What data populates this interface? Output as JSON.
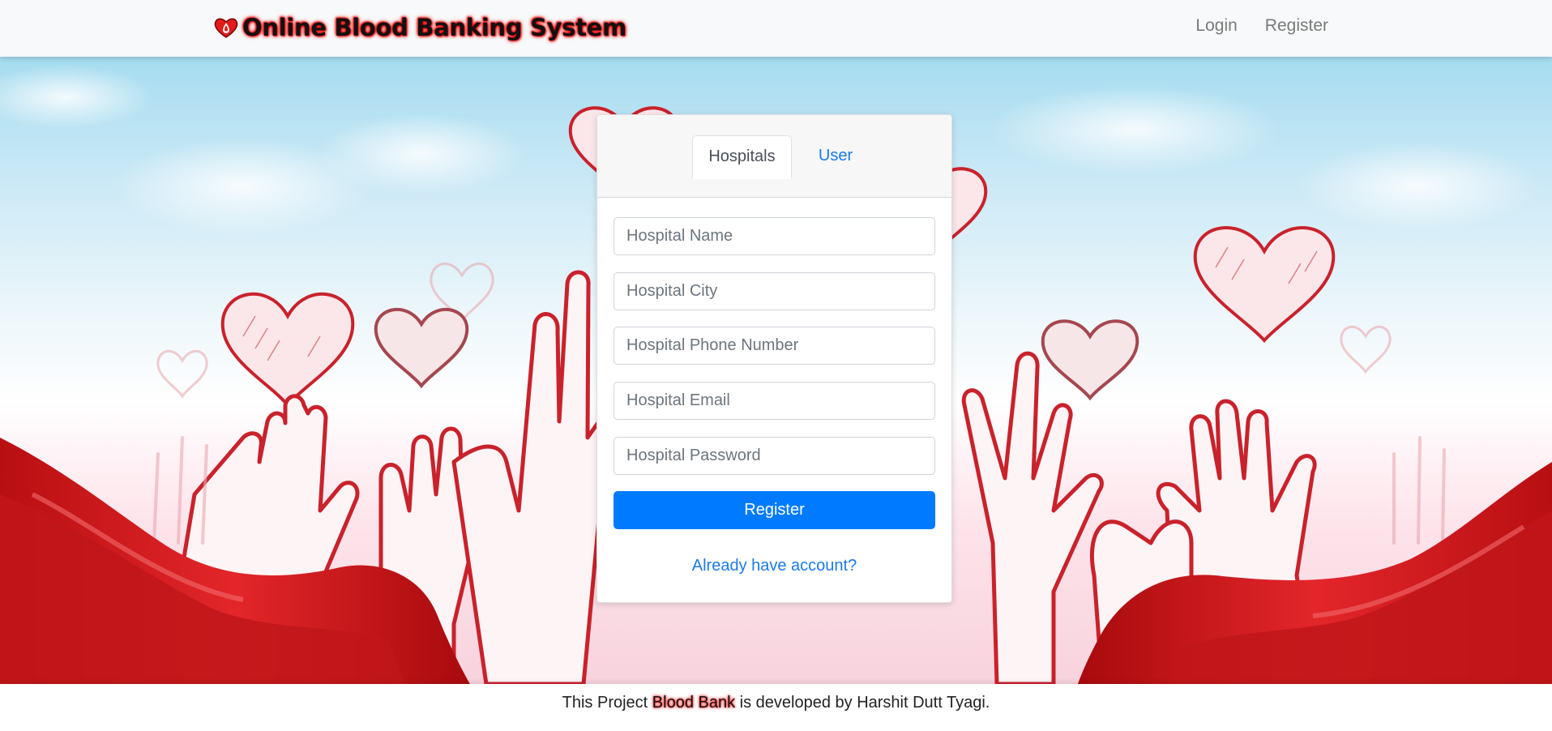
{
  "navbar": {
    "brand_icon": "blood-drop-heart-icon",
    "brand_text": "Online Blood Banking System",
    "links": {
      "login": "Login",
      "register": "Register"
    }
  },
  "card": {
    "tabs": {
      "hospitals": "Hospitals",
      "user": "User"
    },
    "fields": {
      "name_placeholder": "Hospital Name",
      "city_placeholder": "Hospital City",
      "phone_placeholder": "Hospital Phone Number",
      "email_placeholder": "Hospital Email",
      "password_placeholder": "Hospital Password"
    },
    "register_label": "Register",
    "already_label": "Already have account?"
  },
  "footer": {
    "prefix": "This Project",
    "highlight": "Blood Bank",
    "suffix": "is developed by Harshit Dutt Tyagi."
  },
  "colors": {
    "primary": "#007bff",
    "link": "#1a7ae8",
    "brand_glow": "#ff0000",
    "ribbon": "#d31a1a",
    "line_art": "#c9222b"
  }
}
